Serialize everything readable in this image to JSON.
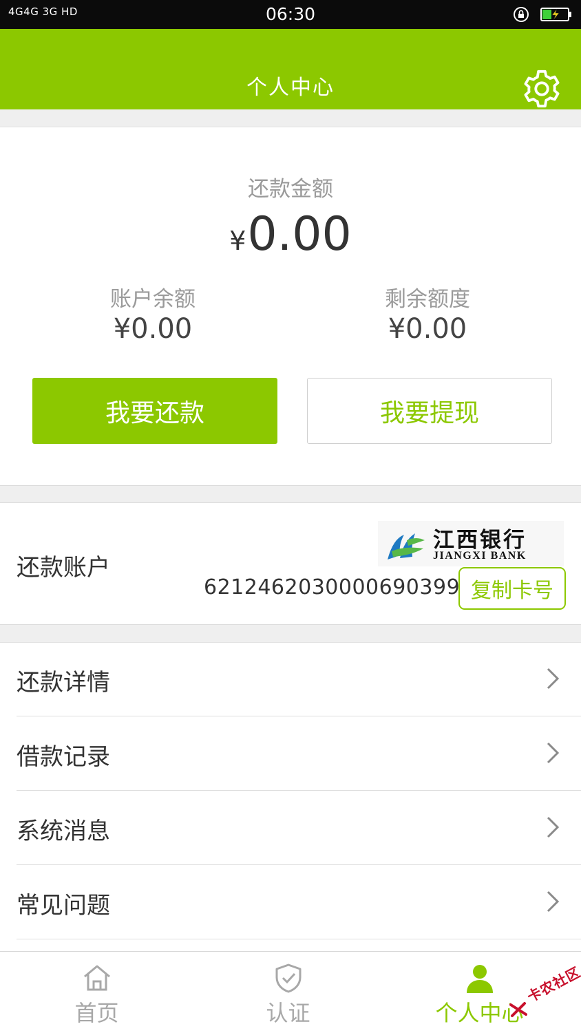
{
  "status_bar": {
    "signal_text": "4G4G 3G HD",
    "time": "06:30",
    "lock_icon": "rotation-lock-icon",
    "battery_icon": "battery-charging-icon"
  },
  "header": {
    "title": "个人中心",
    "settings_icon": "gear-icon"
  },
  "summary": {
    "repay_label": "还款金额",
    "repay_currency": "¥",
    "repay_amount": "0.00",
    "balance_label": "账户余额",
    "balance_value": "¥0.00",
    "remaining_label": "剩余额度",
    "remaining_value": "¥0.00",
    "repay_button": "我要还款",
    "withdraw_button": "我要提现"
  },
  "account": {
    "label": "还款账户",
    "bank_name_cn": "江西银行",
    "bank_name_en": "JIANGXI BANK",
    "card_number": "6212462030000690399",
    "copy_button": "复制卡号"
  },
  "menu": [
    {
      "label": "还款详情",
      "icon": "chevron-right-icon"
    },
    {
      "label": "借款记录",
      "icon": "chevron-right-icon"
    },
    {
      "label": "系统消息",
      "icon": "chevron-right-icon"
    },
    {
      "label": "常见问题",
      "icon": "chevron-right-icon"
    }
  ],
  "bottom_nav": {
    "tabs": [
      {
        "label": "首页",
        "icon": "home-icon",
        "active": false
      },
      {
        "label": "认证",
        "icon": "shield-check-icon",
        "active": false
      },
      {
        "label": "个人中心",
        "icon": "user-icon",
        "active": true
      }
    ]
  },
  "watermark": "卡农社区",
  "colors": {
    "accent": "#8cc800",
    "status_bar": "#0b0b0b",
    "text_dark": "#333333",
    "text_muted": "#9a9a9a",
    "watermark": "#c8112d"
  }
}
